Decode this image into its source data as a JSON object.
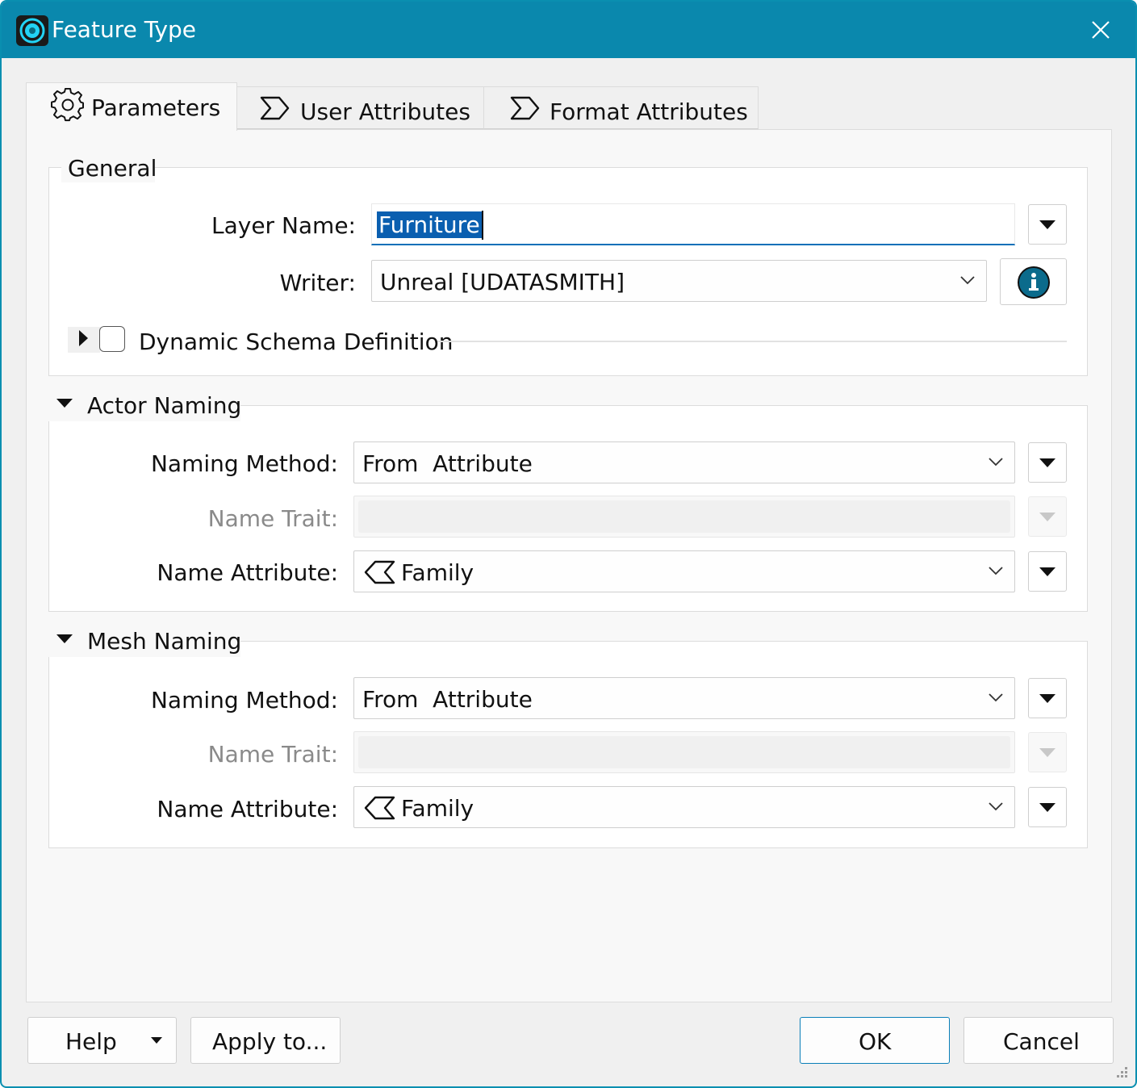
{
  "window": {
    "title": "Feature Type",
    "app_icon": "fme-app-icon",
    "close_icon": "close-icon"
  },
  "tabs": [
    {
      "label": "Parameters",
      "icon": "gear-icon",
      "active": true
    },
    {
      "label": "User Attributes",
      "icon": "attribute-arrow-icon",
      "active": false
    },
    {
      "label": "Format Attributes",
      "icon": "attribute-arrow-icon",
      "active": false
    }
  ],
  "general": {
    "title": "General",
    "layer_name_label": "Layer Name:",
    "layer_name_value": "Furniture",
    "writer_label": "Writer:",
    "writer_value": "Unreal [UDATASMITH]",
    "dynamic_schema_label": "Dynamic Schema Definition",
    "dynamic_schema_checked": false
  },
  "actor_naming": {
    "title": "Actor Naming",
    "naming_method_label": "Naming Method:",
    "naming_method_value": "From  Attribute",
    "name_trait_label": "Name Trait:",
    "name_trait_value": "",
    "name_attribute_label": "Name Attribute:",
    "name_attribute_value": "Family"
  },
  "mesh_naming": {
    "title": "Mesh Naming",
    "naming_method_label": "Naming Method:",
    "naming_method_value": "From  Attribute",
    "name_trait_label": "Name Trait:",
    "name_trait_value": "",
    "name_attribute_label": "Name Attribute:",
    "name_attribute_value": "Family"
  },
  "buttons": {
    "help": "Help",
    "apply_to": "Apply to...",
    "ok": "OK",
    "cancel": "Cancel"
  },
  "colors": {
    "titlebar": "#0a88ad",
    "selection": "#0a5fb0",
    "info_icon": "#0b6b8c"
  }
}
